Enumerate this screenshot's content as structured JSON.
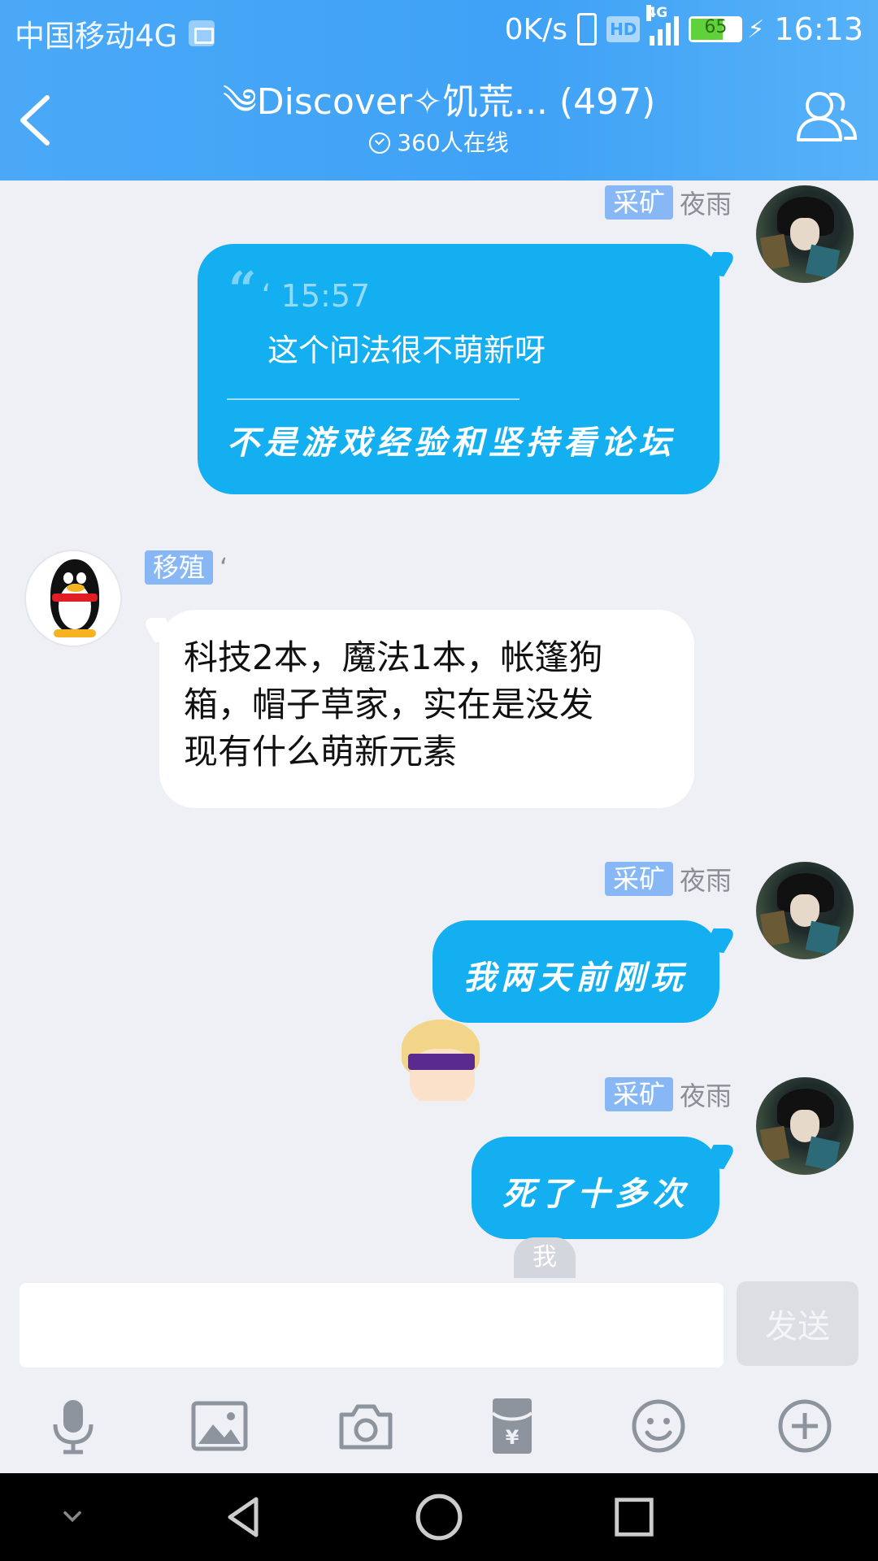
{
  "status_bar": {
    "carrier": "中国移动4G",
    "speed": "0K/s",
    "hd": "HD",
    "network": "4G",
    "battery": "65",
    "time": "16:13"
  },
  "header": {
    "title": "༄Discover✧饥荒...",
    "member_count": "(497)",
    "online": "360人在线"
  },
  "messages": [
    {
      "side": "right",
      "badge": "采矿",
      "nick": "夜雨",
      "quote_mark": "“",
      "quote_time": "‘ 15:57",
      "quote_text": "这个问法很不萌新呀",
      "text": "不是游戏经验和坚持看论坛"
    },
    {
      "side": "left",
      "badge": "移殖",
      "nick": "‘",
      "lines": [
        "科技2本，魔法1本，帐篷狗",
        "箱，帽子草家，实在是没发",
        "现有什么萌新元素"
      ]
    },
    {
      "side": "right",
      "badge": "采矿",
      "nick": "夜雨",
      "text": "我两天前刚玩"
    },
    {
      "side": "right",
      "badge": "采矿",
      "nick": "夜雨",
      "text": "死了十多次"
    }
  ],
  "me_label": "我",
  "input": {
    "value": "",
    "send_label": "发送"
  },
  "toolbar": [
    "microphone-icon",
    "image-icon",
    "camera-icon",
    "red-packet-icon",
    "emoji-icon",
    "plus-icon"
  ],
  "colors": {
    "header": "#3fa2f6",
    "bubble_blue": "#14aff1",
    "badge": "#87b8f5",
    "chat_bg": "#eef0f6"
  }
}
